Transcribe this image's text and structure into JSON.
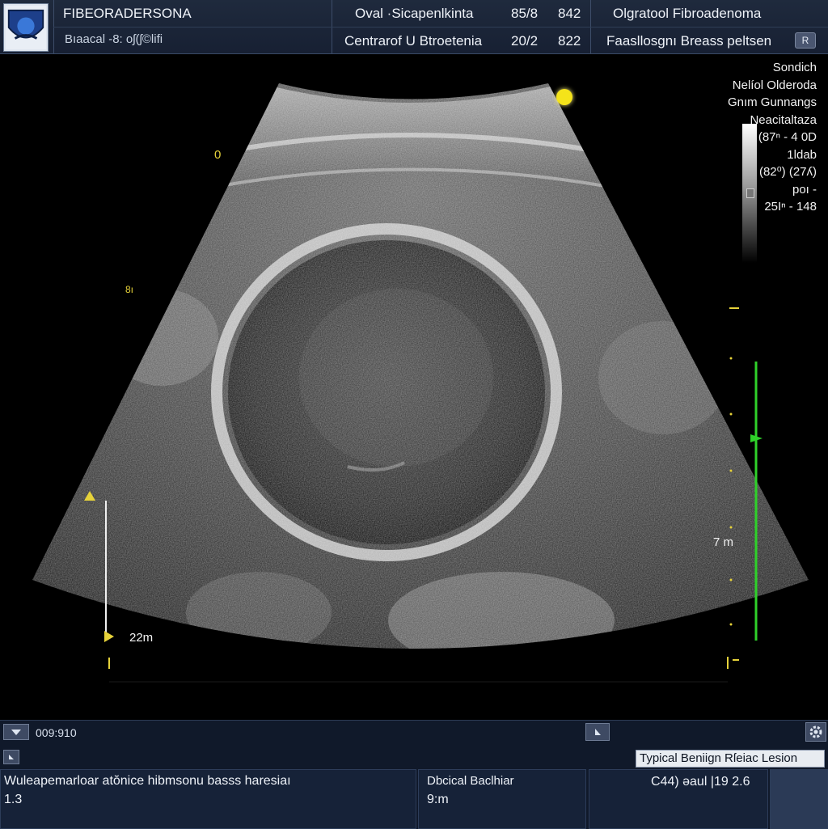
{
  "header": {
    "title": "FIBEORADERSONA",
    "subtitle": "Bıaacal -8: oʃ(ʃ©lifi",
    "row1": {
      "shape": "Oval ·Sicapenlkinta",
      "val_a": "85/8",
      "val_b": "842",
      "diagnosis": "Olgratool Fibroadenoma"
    },
    "row2": {
      "shape": "Centrarof U Btroetenia",
      "val_a": "20/2",
      "val_b": "822",
      "diagnosis": "Faasllosgnı Breass peltsen"
    },
    "right_button": "R"
  },
  "overlay": {
    "right_info": [
      "Sondich",
      "Nelíol Olderoda",
      "Gnım Gunnangs",
      "Neacitaltaza",
      "(87ⁿ - 4 0D",
      "1ldab",
      "(82⁰) (27ʎ)",
      "poı -",
      "25Iⁿ - 148"
    ],
    "left_top_mark": "0",
    "left_mid_mark": "8ı",
    "depth_left": "22m",
    "depth_right": "7 m",
    "colors": {
      "caliper_yellow": "#e6d23a",
      "focus_yellow": "#f4e31a",
      "scale_green": "#2fd12a"
    },
    "icons": [
      "focus-dot-icon",
      "caliper-arrow-icon",
      "grayscale-bar"
    ]
  },
  "bottom": {
    "time": "009:910",
    "tag": "Typical Beniign Rſeiac Lesion",
    "cell1": {
      "line1": "Wuleapemarloar atŏnice hibmsonu basss haresiaı",
      "line2": "1.3"
    },
    "cell2": {
      "line1": "Dbcical Baclhiar",
      "line2": "9:m"
    },
    "cell3": {
      "line1": "C44) ǝaul |19 2.6"
    }
  }
}
